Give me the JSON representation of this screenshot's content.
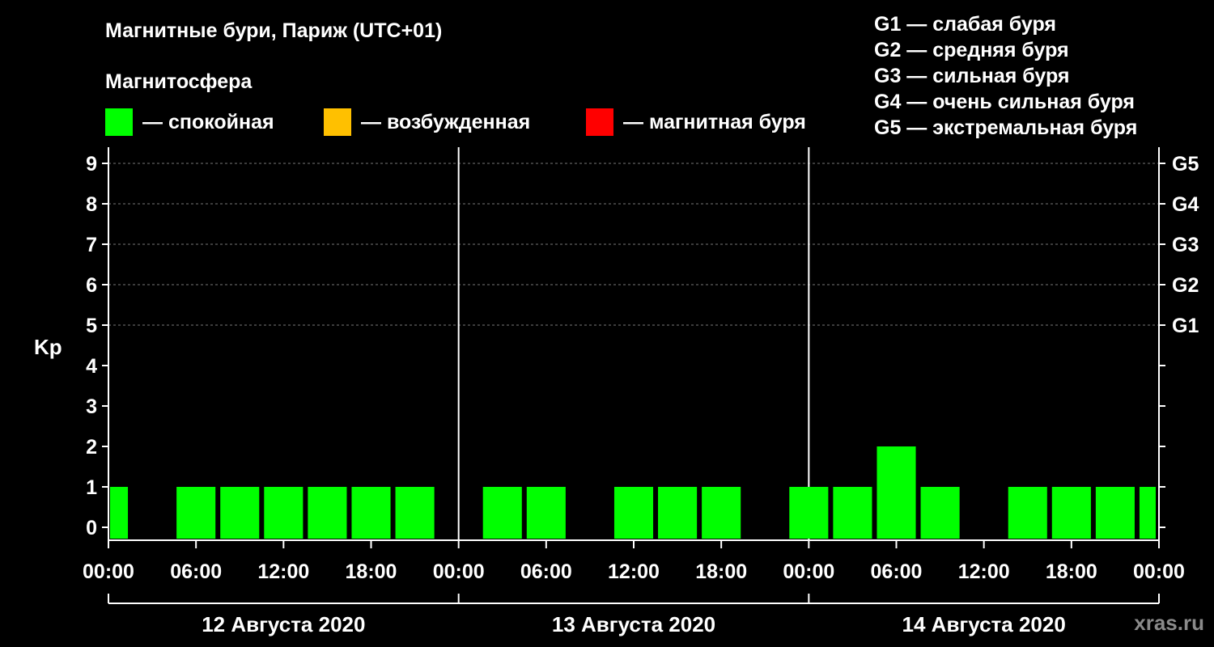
{
  "header": {
    "title": "Магнитные бури, Париж (UTC+01)",
    "subtitle": "Магнитосфера"
  },
  "legend": [
    {
      "label": "— спокойная",
      "color": "#00ff00"
    },
    {
      "label": "— возбужденная",
      "color": "#ffc000"
    },
    {
      "label": "— магнитная буря",
      "color": "#ff0000"
    }
  ],
  "g_levels": [
    "G1 — слабая буря",
    "G2 — средняя буря",
    "G3 — сильная буря",
    "G4 — очень сильная буря",
    "G5 — экстремальная буря"
  ],
  "footer": {
    "site": "xras.ru"
  },
  "chart_data": {
    "type": "bar",
    "ylabel": "Kp",
    "ylim": [
      0,
      9
    ],
    "yticks": [
      0,
      1,
      2,
      3,
      4,
      5,
      6,
      7,
      8,
      9
    ],
    "right_ticks": [
      {
        "value": 5,
        "label": "G1"
      },
      {
        "value": 6,
        "label": "G2"
      },
      {
        "value": 7,
        "label": "G3"
      },
      {
        "value": 8,
        "label": "G4"
      },
      {
        "value": 9,
        "label": "G5"
      }
    ],
    "grid": "dashed horizontal",
    "days": [
      "12 Августа 2020",
      "13 Августа 2020",
      "14 Августа 2020"
    ],
    "xtick_labels": [
      "00:00",
      "06:00",
      "12:00",
      "18:00",
      "00:00",
      "06:00",
      "12:00",
      "18:00",
      "00:00",
      "06:00",
      "12:00",
      "18:00",
      "00:00"
    ],
    "interval_hours": 3,
    "series": [
      {
        "values": [
          1,
          0,
          1,
          1,
          1,
          1,
          1,
          1,
          0,
          1,
          1,
          0,
          1,
          1,
          1,
          0,
          1,
          1,
          2,
          1,
          0,
          1,
          1,
          1,
          1
        ],
        "colors": [
          "#00ff00"
        ]
      }
    ]
  }
}
